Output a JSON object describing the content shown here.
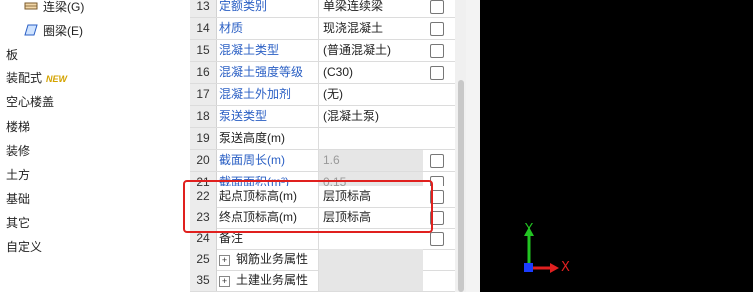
{
  "sidebar": {
    "sub_items": [
      {
        "label": "连梁(G)",
        "icon": "beam-icon"
      },
      {
        "label": "圈梁(E)",
        "icon": "ring-beam-icon"
      }
    ],
    "items": [
      {
        "label": "板"
      },
      {
        "label": "装配式",
        "badge": "NEW"
      },
      {
        "label": "空心楼盖"
      },
      {
        "label": "楼梯"
      },
      {
        "label": "装修"
      },
      {
        "label": "土方"
      },
      {
        "label": "基础"
      },
      {
        "label": "其它"
      },
      {
        "label": "自定义"
      }
    ]
  },
  "properties": {
    "rows": [
      {
        "num": "13",
        "name": "定额类别",
        "value": "单梁连续梁",
        "checkbox": true
      },
      {
        "num": "14",
        "name": "材质",
        "value": "现浇混凝土",
        "checkbox": true
      },
      {
        "num": "15",
        "name": "混凝土类型",
        "value": "(普通混凝土)",
        "checkbox": true
      },
      {
        "num": "16",
        "name": "混凝土强度等级",
        "value": "(C30)",
        "checkbox": true
      },
      {
        "num": "17",
        "name": "混凝土外加剂",
        "value": "(无)",
        "checkbox": false
      },
      {
        "num": "18",
        "name": "泵送类型",
        "value": "(混凝土泵)",
        "checkbox": false
      },
      {
        "num": "19",
        "name": "泵送高度(m)",
        "value": "",
        "checkbox": false
      },
      {
        "num": "20",
        "name": "截面周长(m)",
        "value": "1.6",
        "checkbox": true
      },
      {
        "num": "21",
        "name": "截面面积(m²)",
        "value": "0.15",
        "checkbox": true
      },
      {
        "num": "22",
        "name": "起点顶标高(m)",
        "value": "层顶标高",
        "checkbox": true
      },
      {
        "num": "23",
        "name": "终点顶标高(m)",
        "value": "层顶标高",
        "checkbox": true
      },
      {
        "num": "24",
        "name": "备注",
        "value": "",
        "checkbox": true
      },
      {
        "num": "25",
        "name": "钢筋业务属性",
        "value": "",
        "checkbox": false,
        "expand": "+"
      },
      {
        "num": "35",
        "name": "土建业务属性",
        "value": "",
        "checkbox": false,
        "expand": "+"
      }
    ]
  },
  "axes": {
    "y_label": "Y",
    "x_label": "X",
    "y_color": "#22c422",
    "x_color": "#e02020",
    "origin_color": "#1a3cff"
  },
  "colors": {
    "highlight": "#e0201e",
    "link_blue": "#2a5fc4"
  }
}
